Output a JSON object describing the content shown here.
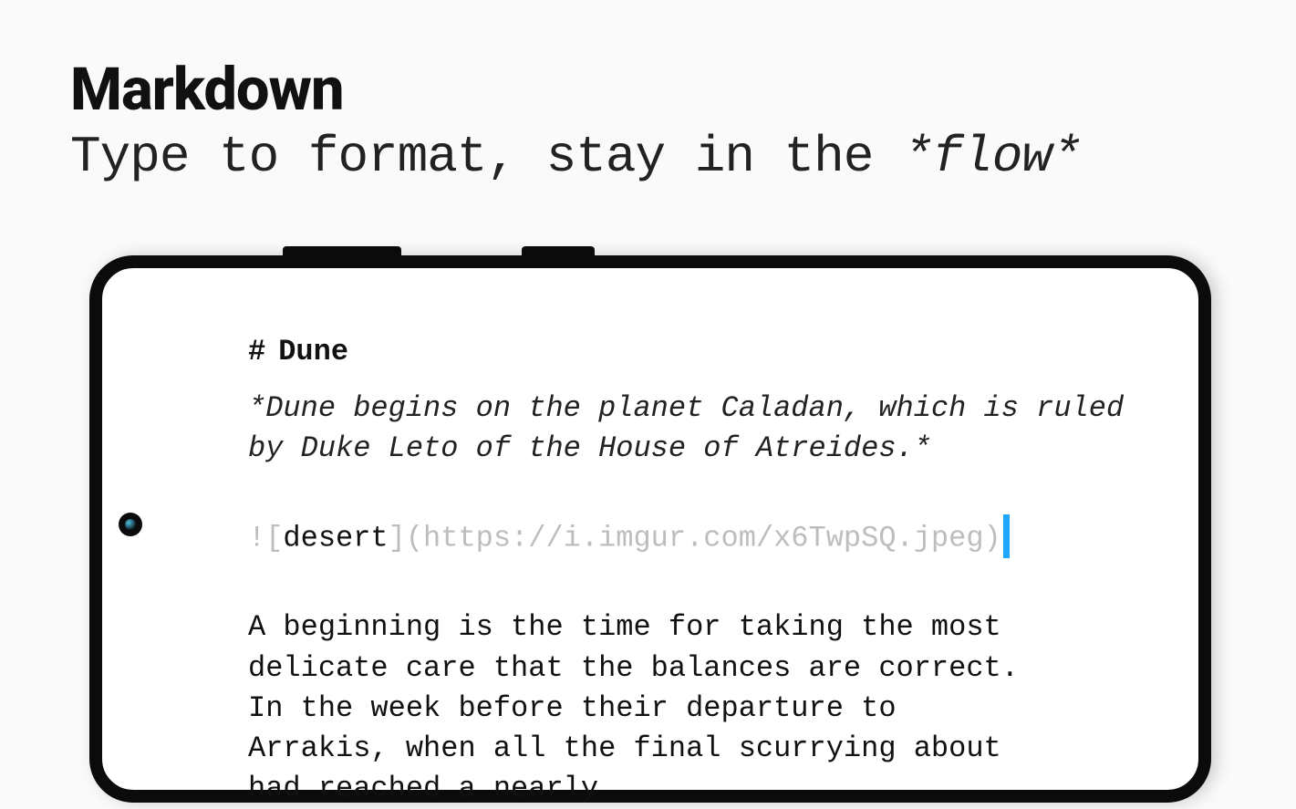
{
  "heading": {
    "title": "Markdown",
    "subtitle_prefix": "Type to format, stay in the ",
    "subtitle_flow": "*flow*"
  },
  "editor": {
    "h1_hash": "#",
    "h1_text": "Dune",
    "intro_italic": "*Dune begins on the planet Caladan, which is ruled by Duke Leto of the House of Atreides.*",
    "img_bang": "!",
    "img_open_bracket": "[",
    "img_alt": "desert",
    "img_close_bracket": "]",
    "img_open_paren": "(",
    "img_url": "https://i.imgur.com/x6TwpSQ.jpeg",
    "img_close_paren": ")",
    "body": "A beginning is the time for taking the most delicate care that the balances are correct. In the week before their departure to Arrakis, when all the final scurrying about had reached a nearly"
  }
}
